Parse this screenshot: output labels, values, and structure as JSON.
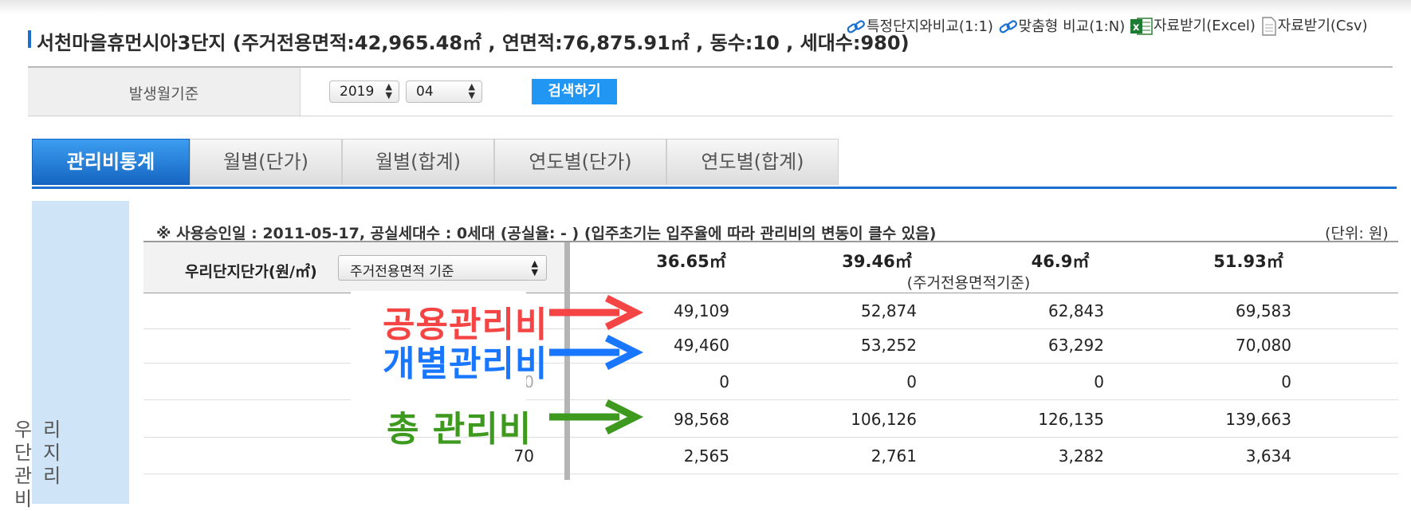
{
  "page": {
    "title": "서천마을휴먼시아3단지 (주거전용면적:42,965.48㎡ , 연면적:76,875.91㎡ , 동수:10 , 세대수:980)"
  },
  "filter": {
    "label": "발생월기준",
    "year": "2019",
    "month": "04",
    "search_label": "검색하기"
  },
  "tabs": [
    "관리비통계",
    "월별(단가)",
    "월별(합계)",
    "연도별(단가)",
    "연도별(합계)"
  ],
  "tools": {
    "compare_one": "특정단지와비교(1:1)",
    "compare_many": "맞춤형 비교(1:N)",
    "excel": "자료받기(Excel)",
    "csv": "자료받기(Csv)"
  },
  "side_label": "우리단지관리비",
  "notice": "※ 사용승인일 : 2011-05-17, 공실세대수 : 0세대 (공실율: - ) (입주초기는 입주율에 따라 관리비의 변동이 클수 있음)",
  "unit": "(단위: 원)",
  "table": {
    "unit_label": "우리단지단가(원/㎡)",
    "area_select": "주거전용면적 기준",
    "columns": [
      "36.65㎡",
      "39.46㎡",
      "46.9㎡",
      "51.93㎡"
    ],
    "column_sub": "(주거전용면적기준)",
    "rows": [
      {
        "left": "",
        "values": [
          "49,109",
          "52,874",
          "62,843",
          "69,583"
        ]
      },
      {
        "left": "",
        "values": [
          "49,460",
          "53,252",
          "63,292",
          "70,080"
        ]
      },
      {
        "left": "0",
        "values": [
          "0",
          "0",
          "0",
          "0"
        ]
      },
      {
        "left": "",
        "values": [
          "98,568",
          "106,126",
          "126,135",
          "139,663"
        ]
      },
      {
        "left": "70",
        "values": [
          "2,565",
          "2,761",
          "3,282",
          "3,634"
        ]
      }
    ]
  },
  "annotations": {
    "common": "공용관리비",
    "individual": "개별관리비",
    "total": "총 관리비",
    "colors": {
      "common": "#f44444",
      "individual": "#1976ff",
      "total": "#3d9a1e"
    }
  }
}
